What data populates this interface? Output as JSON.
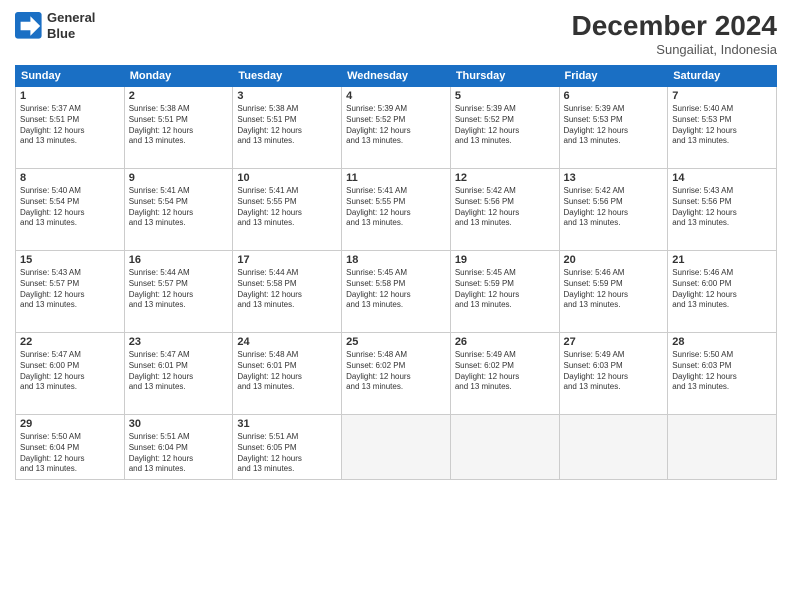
{
  "header": {
    "logo_line1": "General",
    "logo_line2": "Blue",
    "month_title": "December 2024",
    "subtitle": "Sungailiat, Indonesia"
  },
  "weekdays": [
    "Sunday",
    "Monday",
    "Tuesday",
    "Wednesday",
    "Thursday",
    "Friday",
    "Saturday"
  ],
  "weeks": [
    [
      {
        "day": "1",
        "info": "Sunrise: 5:37 AM\nSunset: 5:51 PM\nDaylight: 12 hours\nand 13 minutes."
      },
      {
        "day": "2",
        "info": "Sunrise: 5:38 AM\nSunset: 5:51 PM\nDaylight: 12 hours\nand 13 minutes."
      },
      {
        "day": "3",
        "info": "Sunrise: 5:38 AM\nSunset: 5:51 PM\nDaylight: 12 hours\nand 13 minutes."
      },
      {
        "day": "4",
        "info": "Sunrise: 5:39 AM\nSunset: 5:52 PM\nDaylight: 12 hours\nand 13 minutes."
      },
      {
        "day": "5",
        "info": "Sunrise: 5:39 AM\nSunset: 5:52 PM\nDaylight: 12 hours\nand 13 minutes."
      },
      {
        "day": "6",
        "info": "Sunrise: 5:39 AM\nSunset: 5:53 PM\nDaylight: 12 hours\nand 13 minutes."
      },
      {
        "day": "7",
        "info": "Sunrise: 5:40 AM\nSunset: 5:53 PM\nDaylight: 12 hours\nand 13 minutes."
      }
    ],
    [
      {
        "day": "8",
        "info": "Sunrise: 5:40 AM\nSunset: 5:54 PM\nDaylight: 12 hours\nand 13 minutes."
      },
      {
        "day": "9",
        "info": "Sunrise: 5:41 AM\nSunset: 5:54 PM\nDaylight: 12 hours\nand 13 minutes."
      },
      {
        "day": "10",
        "info": "Sunrise: 5:41 AM\nSunset: 5:55 PM\nDaylight: 12 hours\nand 13 minutes."
      },
      {
        "day": "11",
        "info": "Sunrise: 5:41 AM\nSunset: 5:55 PM\nDaylight: 12 hours\nand 13 minutes."
      },
      {
        "day": "12",
        "info": "Sunrise: 5:42 AM\nSunset: 5:56 PM\nDaylight: 12 hours\nand 13 minutes."
      },
      {
        "day": "13",
        "info": "Sunrise: 5:42 AM\nSunset: 5:56 PM\nDaylight: 12 hours\nand 13 minutes."
      },
      {
        "day": "14",
        "info": "Sunrise: 5:43 AM\nSunset: 5:56 PM\nDaylight: 12 hours\nand 13 minutes."
      }
    ],
    [
      {
        "day": "15",
        "info": "Sunrise: 5:43 AM\nSunset: 5:57 PM\nDaylight: 12 hours\nand 13 minutes."
      },
      {
        "day": "16",
        "info": "Sunrise: 5:44 AM\nSunset: 5:57 PM\nDaylight: 12 hours\nand 13 minutes."
      },
      {
        "day": "17",
        "info": "Sunrise: 5:44 AM\nSunset: 5:58 PM\nDaylight: 12 hours\nand 13 minutes."
      },
      {
        "day": "18",
        "info": "Sunrise: 5:45 AM\nSunset: 5:58 PM\nDaylight: 12 hours\nand 13 minutes."
      },
      {
        "day": "19",
        "info": "Sunrise: 5:45 AM\nSunset: 5:59 PM\nDaylight: 12 hours\nand 13 minutes."
      },
      {
        "day": "20",
        "info": "Sunrise: 5:46 AM\nSunset: 5:59 PM\nDaylight: 12 hours\nand 13 minutes."
      },
      {
        "day": "21",
        "info": "Sunrise: 5:46 AM\nSunset: 6:00 PM\nDaylight: 12 hours\nand 13 minutes."
      }
    ],
    [
      {
        "day": "22",
        "info": "Sunrise: 5:47 AM\nSunset: 6:00 PM\nDaylight: 12 hours\nand 13 minutes."
      },
      {
        "day": "23",
        "info": "Sunrise: 5:47 AM\nSunset: 6:01 PM\nDaylight: 12 hours\nand 13 minutes."
      },
      {
        "day": "24",
        "info": "Sunrise: 5:48 AM\nSunset: 6:01 PM\nDaylight: 12 hours\nand 13 minutes."
      },
      {
        "day": "25",
        "info": "Sunrise: 5:48 AM\nSunset: 6:02 PM\nDaylight: 12 hours\nand 13 minutes."
      },
      {
        "day": "26",
        "info": "Sunrise: 5:49 AM\nSunset: 6:02 PM\nDaylight: 12 hours\nand 13 minutes."
      },
      {
        "day": "27",
        "info": "Sunrise: 5:49 AM\nSunset: 6:03 PM\nDaylight: 12 hours\nand 13 minutes."
      },
      {
        "day": "28",
        "info": "Sunrise: 5:50 AM\nSunset: 6:03 PM\nDaylight: 12 hours\nand 13 minutes."
      }
    ],
    [
      {
        "day": "29",
        "info": "Sunrise: 5:50 AM\nSunset: 6:04 PM\nDaylight: 12 hours\nand 13 minutes."
      },
      {
        "day": "30",
        "info": "Sunrise: 5:51 AM\nSunset: 6:04 PM\nDaylight: 12 hours\nand 13 minutes."
      },
      {
        "day": "31",
        "info": "Sunrise: 5:51 AM\nSunset: 6:05 PM\nDaylight: 12 hours\nand 13 minutes."
      },
      {
        "day": "",
        "info": ""
      },
      {
        "day": "",
        "info": ""
      },
      {
        "day": "",
        "info": ""
      },
      {
        "day": "",
        "info": ""
      }
    ]
  ]
}
